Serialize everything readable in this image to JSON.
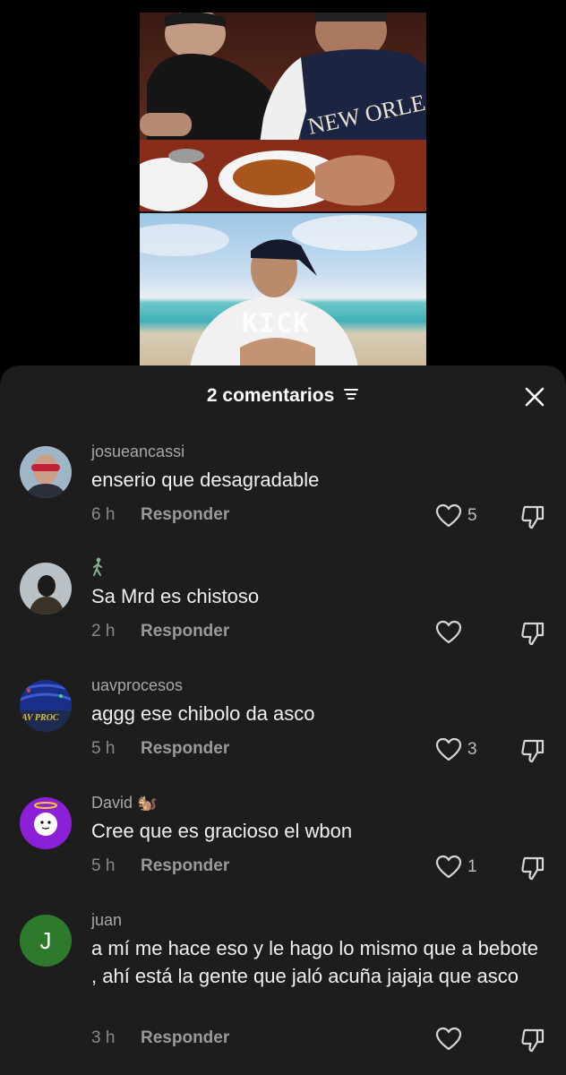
{
  "sheet": {
    "title": "2 comentarios",
    "close_icon": "close-icon",
    "filter_icon": "sort-filter-icon"
  },
  "comments": [
    {
      "user": "josueancassi",
      "text": "enserio que desagradable",
      "time": "6 h",
      "reply": "Responder",
      "likes": "5"
    },
    {
      "user": "",
      "text": "Sa Mrd es chistoso",
      "time": "2 h",
      "reply": "Responder",
      "likes": ""
    },
    {
      "user": "uavprocesos",
      "text": "aggg ese chibolo da asco",
      "time": "5 h",
      "reply": "Responder",
      "likes": "3",
      "avatar_text": "AV PROC"
    },
    {
      "user": "David 🐿️",
      "text": "Cree que es gracioso el wbon",
      "time": "5 h",
      "reply": "Responder",
      "likes": "1"
    },
    {
      "user": "juan",
      "text": "a mí me hace eso y le hago lo mismo que a bebote , ahí está la gente que jaló acuña jajaja que asco",
      "time": "3 h",
      "reply": "Responder",
      "likes": "",
      "avatar_initial": "J"
    }
  ],
  "video": {
    "watermark": "KICK"
  },
  "colors": {
    "sheet_bg": "#1d1d1d",
    "text": "#f0f0f0",
    "muted": "#8a8a8a"
  }
}
